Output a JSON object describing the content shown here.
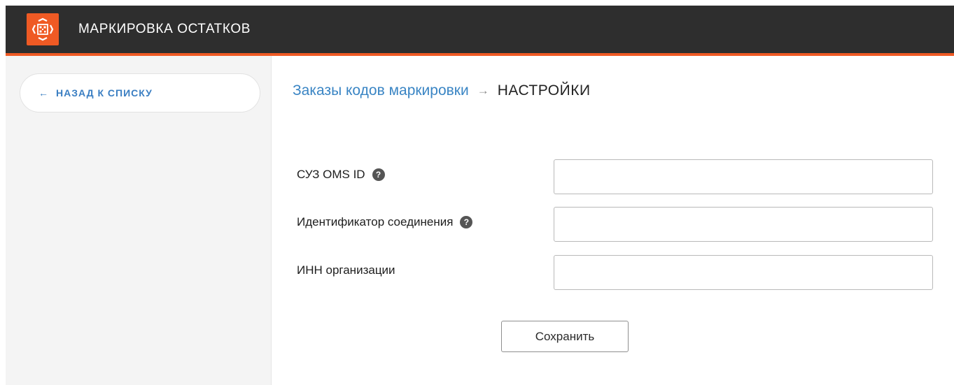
{
  "header": {
    "app_title": "МАРКИРОВКА ОСТАТКОВ",
    "logo_icon": "barcode-scan-icon",
    "background_color": "#2e2e2e",
    "accent_color": "#ef5a24"
  },
  "sidebar": {
    "back_button": {
      "arrow": "←",
      "label": "НАЗАД К СПИСКУ"
    }
  },
  "breadcrumb": {
    "parent": "Заказы кодов маркировки",
    "separator": "→",
    "current": "НАСТРОЙКИ"
  },
  "form": {
    "fields": [
      {
        "label": "СУЗ OMS ID",
        "help": "?",
        "value": ""
      },
      {
        "label": "Идентификатор соединения",
        "help": "?",
        "value": ""
      },
      {
        "label": "ИНН организации",
        "value": ""
      }
    ],
    "save_label": "Сохранить"
  },
  "colors": {
    "link": "#3a85c4",
    "back_link": "#3a7ec2"
  }
}
